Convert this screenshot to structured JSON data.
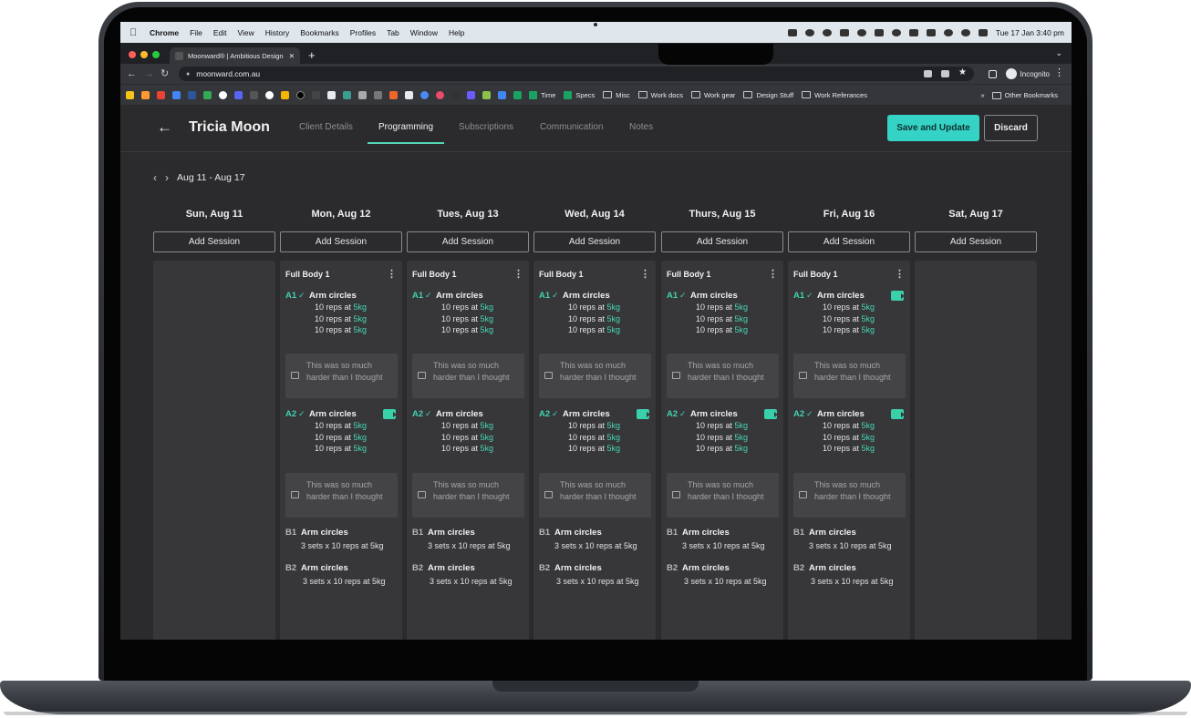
{
  "menubar": {
    "items": [
      "Chrome",
      "File",
      "Edit",
      "View",
      "History",
      "Bookmarks",
      "Profiles",
      "Tab",
      "Window",
      "Help"
    ],
    "clock": "Tue 17 Jan  3:40 pm"
  },
  "browser": {
    "tab_title": "Moonward® | Ambitious Design",
    "url": "moonward.com.au",
    "incognito_label": "Incognito",
    "bookmarks": [
      "Time",
      "Specs",
      "Misc",
      "Work docs",
      "Work gear",
      "Design Stuff",
      "Work Referances"
    ],
    "other_bookmarks": "Other Bookmarks"
  },
  "header": {
    "client_name": "Tricia Moon",
    "tabs": [
      "Client Details",
      "Programming",
      "Subscriptions",
      "Communication",
      "Notes"
    ],
    "active_tab": "Programming",
    "save_label": "Save and Update",
    "discard_label": "Discard"
  },
  "week_range": "Aug 11 - Aug 17",
  "add_session_label": "Add Session",
  "days": [
    {
      "title": "Sun, Aug 11"
    },
    {
      "title": "Mon, Aug 12"
    },
    {
      "title": "Tues, Aug 13"
    },
    {
      "title": "Wed, Aug 14"
    },
    {
      "title": "Thurs, Aug 15"
    },
    {
      "title": "Fri, Aug 16"
    },
    {
      "title": "Sat, Aug 17"
    }
  ],
  "session": {
    "title": "Full Body 1",
    "a1": {
      "code": "A1",
      "name": "Arm circles",
      "sets": [
        "10 reps at ",
        "10 reps at ",
        "10 reps at "
      ],
      "weight": "5kg"
    },
    "a2": {
      "code": "A2",
      "name": "Arm circles",
      "sets": [
        "10 reps at ",
        "10 reps at ",
        "10 reps at "
      ],
      "weight": "5kg"
    },
    "note": "This was so much harder than I thought",
    "b1": {
      "code": "B1",
      "name": "Arm circles",
      "detail": "3 sets x 10 reps at 5kg"
    },
    "b2": {
      "code": "B2",
      "name": "Arm circles",
      "detail": "3 sets x 10 reps at 5kg"
    }
  },
  "colors": {
    "accent": "#35d3c6",
    "check": "#3fd0b0",
    "background": "#2b2b2d",
    "column": "#373739"
  },
  "icons": {
    "back": "arrow-left-icon",
    "prev": "chevron-left-icon",
    "next": "chevron-right-icon",
    "check": "check-icon",
    "video": "video-icon",
    "note": "comment-icon",
    "menu": "kebab-menu-icon"
  }
}
